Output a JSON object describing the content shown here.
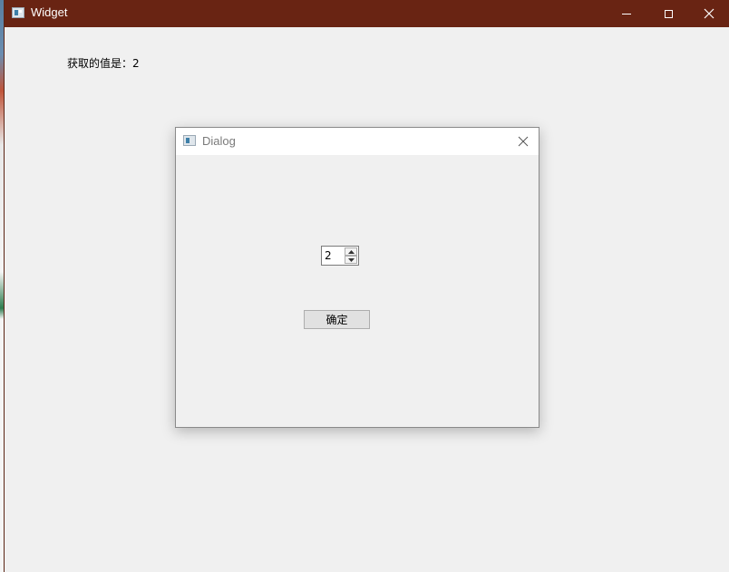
{
  "main_window": {
    "title": "Widget",
    "value_label": "获取的值是：2"
  },
  "dialog": {
    "title": "Dialog",
    "spinbox_value": "2",
    "ok_button_label": "确定"
  },
  "colors": {
    "titlebar": "#692413",
    "window_bg": "#f0f0f0",
    "dialog_titlebar": "#ffffff",
    "button_bg": "#e1e1e1"
  },
  "icons": [
    "app-icon",
    "minimize-icon",
    "maximize-icon",
    "close-icon",
    "chevron-up-icon",
    "chevron-down-icon"
  ]
}
